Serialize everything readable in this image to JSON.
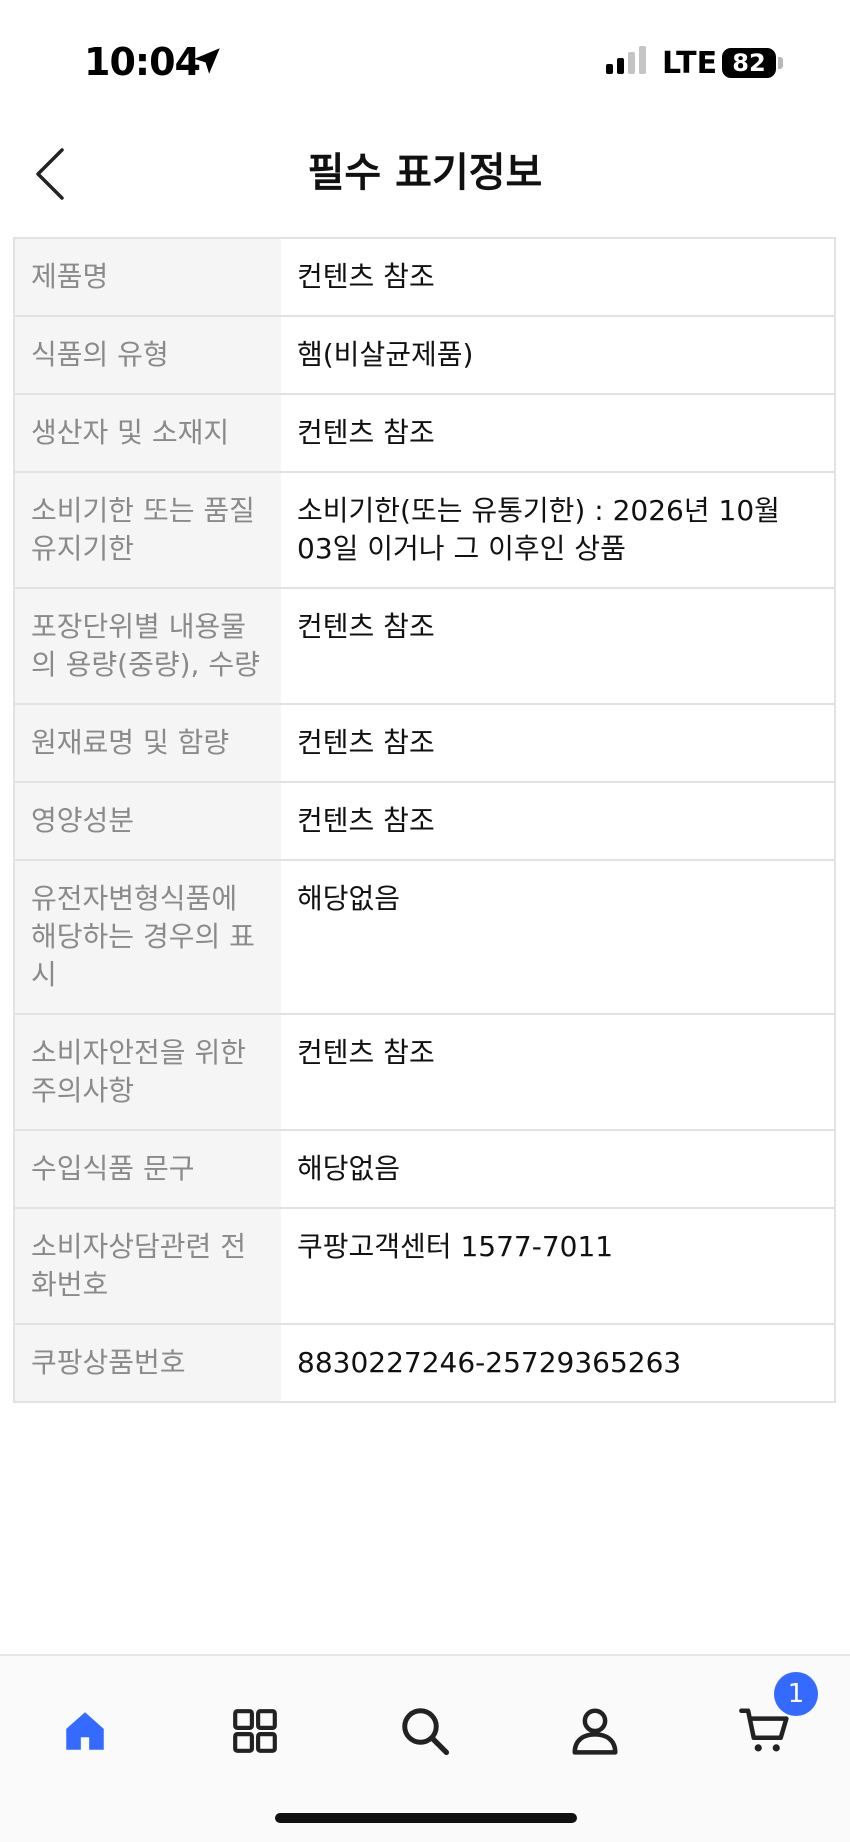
{
  "status_bar": {
    "time": "10:04",
    "network": "LTE",
    "battery": "82"
  },
  "header": {
    "title": "필수 표기정보",
    "back_icon": "chevron-left-icon"
  },
  "table": {
    "rows": [
      {
        "key": "제품명",
        "value": "컨텐츠 참조"
      },
      {
        "key": "식품의 유형",
        "value": "햄(비살균제품)"
      },
      {
        "key": "생산자 및 소재지",
        "value": "컨텐츠 참조"
      },
      {
        "key": "소비기한 또는 품질유지기한",
        "value": "소비기한(또는 유통기한) : 2026년 10월 03일 이거나 그 이후인 상품"
      },
      {
        "key": "포장단위별 내용물의 용량(중량), 수량",
        "value": "컨텐츠 참조"
      },
      {
        "key": "원재료명 및 함량",
        "value": "컨텐츠 참조"
      },
      {
        "key": "영양성분",
        "value": "컨텐츠 참조"
      },
      {
        "key": "유전자변형식품에 해당하는 경우의 표시",
        "value": "해당없음"
      },
      {
        "key": "소비자안전을 위한 주의사항",
        "value": "컨텐츠 참조"
      },
      {
        "key": "수입식품 문구",
        "value": "해당없음"
      },
      {
        "key": "소비자상담관련 전화번호",
        "value": "쿠팡고객센터 1577-7011"
      },
      {
        "key": "쿠팡상품번호",
        "value": "8830227246-25729365263"
      }
    ]
  },
  "bottom_nav": {
    "items": [
      "home-icon",
      "categories-icon",
      "search-icon",
      "profile-icon",
      "cart-icon"
    ],
    "cart_count": "1",
    "accent_color": "#346aff"
  }
}
